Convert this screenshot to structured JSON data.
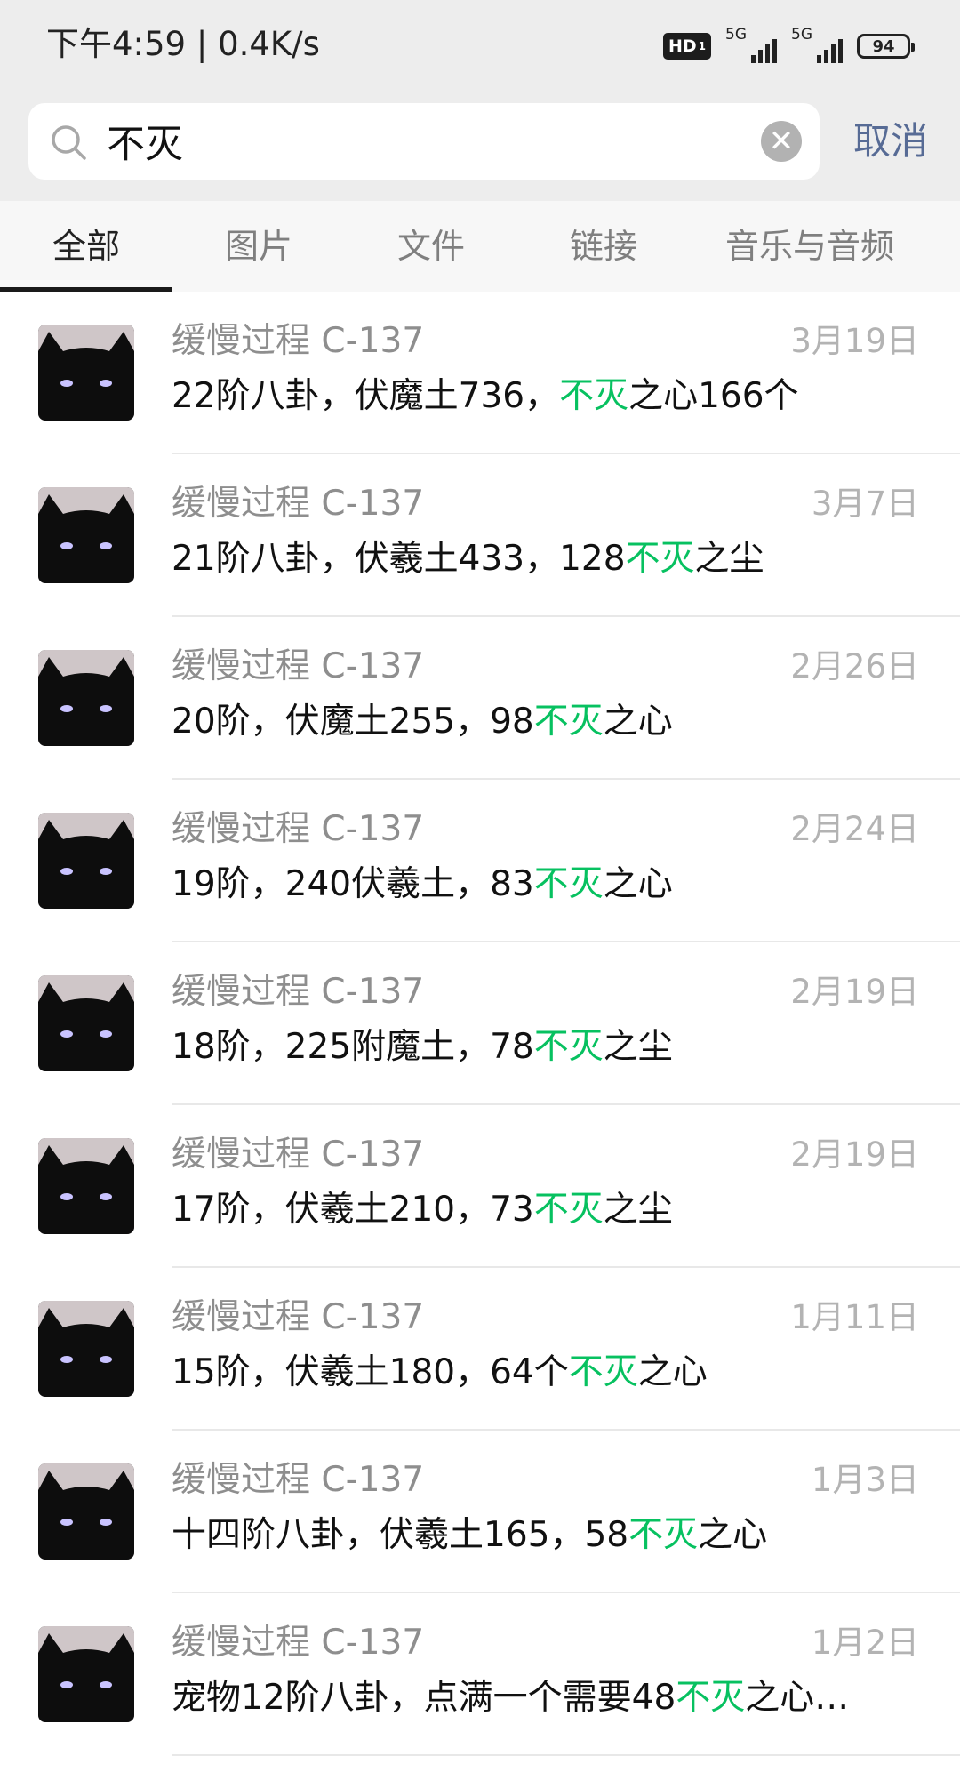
{
  "status_bar": {
    "time_speed": "下午4:59 | 0.4K/s",
    "hd_label": "HD",
    "hd_sub": "1",
    "signal_1_label": "5G",
    "signal_2_label": "5G",
    "battery": "94"
  },
  "search": {
    "query": "不灭",
    "cancel_label": "取消"
  },
  "tabs": [
    {
      "label": "全部",
      "active": true
    },
    {
      "label": "图片",
      "active": false
    },
    {
      "label": "文件",
      "active": false
    },
    {
      "label": "链接",
      "active": false
    },
    {
      "label": "音乐与音频",
      "active": false
    }
  ],
  "results": [
    {
      "sender": "缓慢过程 C-137",
      "date": "3月19日",
      "pre": "22阶八卦，伏魔土736，",
      "hl": "不灭",
      "post": "之心166个"
    },
    {
      "sender": "缓慢过程 C-137",
      "date": "3月7日",
      "pre": "21阶八卦，伏羲土433，128",
      "hl": "不灭",
      "post": "之尘"
    },
    {
      "sender": "缓慢过程 C-137",
      "date": "2月26日",
      "pre": "20阶，伏魔土255，98",
      "hl": "不灭",
      "post": "之心"
    },
    {
      "sender": "缓慢过程 C-137",
      "date": "2月24日",
      "pre": "19阶，240伏羲土，83",
      "hl": "不灭",
      "post": "之心"
    },
    {
      "sender": "缓慢过程 C-137",
      "date": "2月19日",
      "pre": "18阶，225附魔土，78",
      "hl": "不灭",
      "post": "之尘"
    },
    {
      "sender": "缓慢过程 C-137",
      "date": "2月19日",
      "pre": "17阶，伏羲土210，73",
      "hl": "不灭",
      "post": "之尘"
    },
    {
      "sender": "缓慢过程 C-137",
      "date": "1月11日",
      "pre": "15阶，伏羲土180，64个",
      "hl": "不灭",
      "post": "之心"
    },
    {
      "sender": "缓慢过程 C-137",
      "date": "1月3日",
      "pre": "十四阶八卦，伏羲土165，58",
      "hl": "不灭",
      "post": "之心"
    },
    {
      "sender": "缓慢过程 C-137",
      "date": "1月2日",
      "pre": "宠物12阶八卦，点满一个需要48",
      "hl": "不灭",
      "post": "之心…"
    }
  ],
  "colors": {
    "highlight": "#07c160",
    "cancel": "#576b95",
    "background_gray": "#ededed"
  }
}
